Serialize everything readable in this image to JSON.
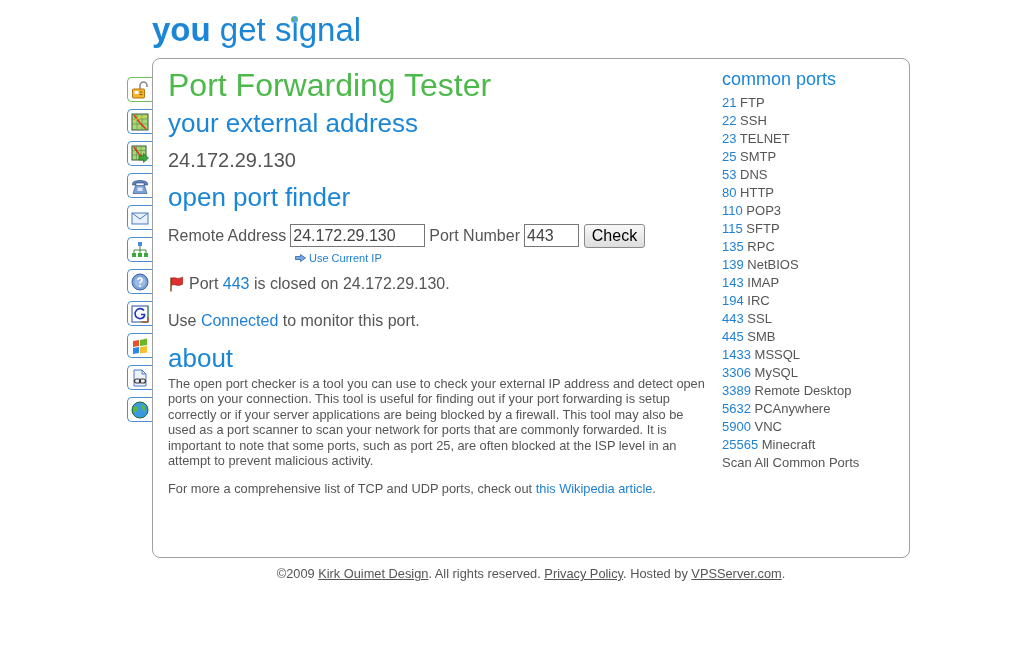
{
  "logo": "**you** get signal",
  "sidebar_tabs": [
    {
      "selected": true
    },
    {
      "selected": false
    },
    {
      "selected": false
    },
    {
      "selected": false
    },
    {
      "selected": false
    },
    {
      "selected": false
    },
    {
      "selected": false
    },
    {
      "selected": false
    },
    {
      "selected": false
    },
    {
      "selected": false
    },
    {
      "selected": false
    }
  ],
  "title": "Port Forwarding Tester",
  "external_address": {
    "heading": "your external address",
    "value": "24.172.29.130"
  },
  "port_finder": {
    "heading": "open port finder",
    "fields": [
      {
        "label": "Remote Address",
        "value": "24.172.29.130"
      },
      {
        "label": "Port Number",
        "value": "443"
      }
    ],
    "button": "Check",
    "use_current_ip": "Use Current IP",
    "result": {
      "open": false,
      "parts": [
        {
          "kind": "text",
          "text": "Port "
        },
        {
          "kind": "link",
          "text": "443"
        },
        {
          "kind": "text",
          "text": " is closed on 24.172.29.130."
        }
      ]
    },
    "monitor": {
      "parts": [
        {
          "kind": "text",
          "text": "Use "
        },
        {
          "kind": "link",
          "text": "Connected"
        },
        {
          "kind": "text",
          "text": " to monitor this port."
        }
      ]
    }
  },
  "about": {
    "heading": "about",
    "paragraphs": [
      {
        "parts": [
          {
            "kind": "text",
            "text": "The open port checker is a tool you can use to check your external IP address and detect open ports on your connection. This tool is useful for finding out if your port forwarding is setup correctly or if your server applications are being blocked by a firewall. This tool may also be used as a port scanner to scan your network for ports that are commonly forwarded. It is important to note that some ports, such as port 25, are often blocked at the ISP level in an attempt to prevent malicious activity."
          }
        ]
      },
      {
        "parts": [
          {
            "kind": "text",
            "text": "For more a comprehensive list of TCP and UDP ports, check out "
          },
          {
            "kind": "link",
            "text": "this Wikipedia article"
          },
          {
            "kind": "text",
            "text": "."
          }
        ]
      }
    ]
  },
  "common_ports": {
    "heading": "common ports",
    "items": [
      {
        "port": "21",
        "name": "FTP"
      },
      {
        "port": "22",
        "name": "SSH"
      },
      {
        "port": "23",
        "name": "TELNET"
      },
      {
        "port": "25",
        "name": "SMTP"
      },
      {
        "port": "53",
        "name": "DNS"
      },
      {
        "port": "80",
        "name": "HTTP"
      },
      {
        "port": "110",
        "name": "POP3"
      },
      {
        "port": "115",
        "name": "SFTP"
      },
      {
        "port": "135",
        "name": "RPC"
      },
      {
        "port": "139",
        "name": "NetBIOS"
      },
      {
        "port": "143",
        "name": "IMAP"
      },
      {
        "port": "194",
        "name": "IRC"
      },
      {
        "port": "443",
        "name": "SSL"
      },
      {
        "port": "445",
        "name": "SMB"
      },
      {
        "port": "1433",
        "name": "MSSQL"
      },
      {
        "port": "3306",
        "name": "MySQL"
      },
      {
        "port": "3389",
        "name": "Remote Desktop"
      },
      {
        "port": "5632",
        "name": "PCAnywhere"
      },
      {
        "port": "5900",
        "name": "VNC"
      },
      {
        "port": "25565",
        "name": "Minecraft"
      }
    ],
    "scan_all": "Scan All Common Ports"
  },
  "footer": {
    "parts": [
      {
        "kind": "text",
        "text": "©2009 "
      },
      {
        "kind": "link",
        "text": "Kirk Ouimet Design"
      },
      {
        "kind": "text",
        "text": ". All rights reserved. "
      },
      {
        "kind": "link",
        "text": "Privacy Policy"
      },
      {
        "kind": "text",
        "text": ". Hosted by "
      },
      {
        "kind": "link",
        "text": "VPSServer.com"
      },
      {
        "kind": "text",
        "text": "."
      }
    ]
  }
}
